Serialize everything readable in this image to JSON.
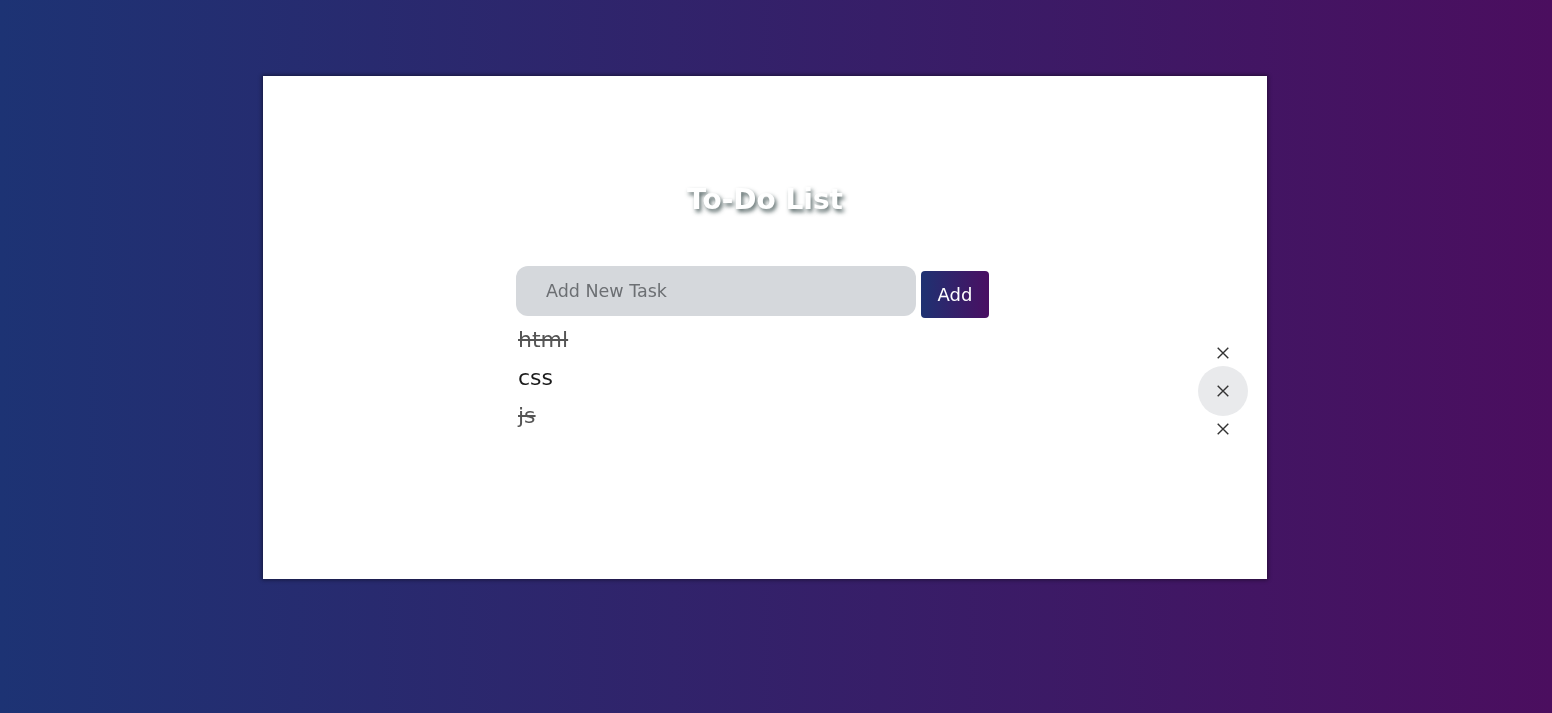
{
  "title": "To-Do List",
  "new_task": {
    "placeholder": "Add New Task",
    "button": "Add"
  },
  "tasks": [
    {
      "text": "html",
      "done": true,
      "hovered": false
    },
    {
      "text": "css",
      "done": false,
      "hovered": true
    },
    {
      "text": "js",
      "done": true,
      "hovered": false
    }
  ]
}
